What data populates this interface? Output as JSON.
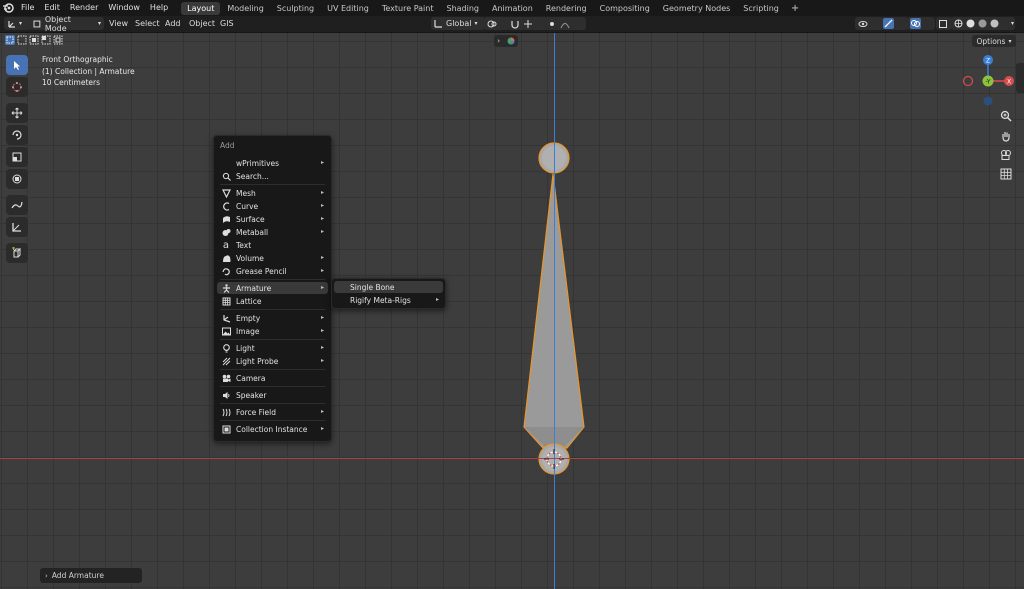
{
  "topbar": {
    "menus": [
      "File",
      "Edit",
      "Render",
      "Window",
      "Help"
    ],
    "workspaces": [
      "Layout",
      "Modeling",
      "Sculpting",
      "UV Editing",
      "Texture Paint",
      "Shading",
      "Animation",
      "Rendering",
      "Compositing",
      "Geometry Nodes",
      "Scripting"
    ],
    "active_workspace": "Layout",
    "add_tab": "+"
  },
  "header": {
    "mode": "Object Mode",
    "menus": [
      "View",
      "Select",
      "Add",
      "Object",
      "GIS"
    ],
    "transform_orientation": "Global",
    "options_label": "Options"
  },
  "viewport": {
    "view_name": "Front Orthographic",
    "collection": "(1) Collection | Armature",
    "scale": "10 Centimeters"
  },
  "gizmo": {
    "z": "Z",
    "y": "-Y",
    "x": "X"
  },
  "add_menu": {
    "title": "Add",
    "items": [
      {
        "label": "wPrimitives",
        "icon": "none",
        "submenu": true
      },
      {
        "label": "Search...",
        "icon": "search-icon",
        "submenu": false
      },
      {
        "label": "Mesh",
        "icon": "mesh-icon",
        "submenu": true
      },
      {
        "label": "Curve",
        "icon": "curve-icon",
        "submenu": true
      },
      {
        "label": "Surface",
        "icon": "surface-icon",
        "submenu": true
      },
      {
        "label": "Metaball",
        "icon": "metaball-icon",
        "submenu": true
      },
      {
        "label": "Text",
        "icon": "text-icon",
        "submenu": false
      },
      {
        "label": "Volume",
        "icon": "volume-icon",
        "submenu": true
      },
      {
        "label": "Grease Pencil",
        "icon": "grease-pencil-icon",
        "submenu": true
      },
      {
        "label": "Armature",
        "icon": "armature-icon",
        "submenu": true
      },
      {
        "label": "Lattice",
        "icon": "lattice-icon",
        "submenu": false
      },
      {
        "label": "Empty",
        "icon": "empty-icon",
        "submenu": true
      },
      {
        "label": "Image",
        "icon": "image-icon",
        "submenu": true
      },
      {
        "label": "Light",
        "icon": "light-icon",
        "submenu": true
      },
      {
        "label": "Light Probe",
        "icon": "light-probe-icon",
        "submenu": true
      },
      {
        "label": "Camera",
        "icon": "camera-icon",
        "submenu": false
      },
      {
        "label": "Speaker",
        "icon": "speaker-icon",
        "submenu": false
      },
      {
        "label": "Force Field",
        "icon": "force-field-icon",
        "submenu": true
      },
      {
        "label": "Collection Instance",
        "icon": "collection-icon",
        "submenu": true
      }
    ],
    "highlighted": "Armature"
  },
  "armature_submenu": {
    "items": [
      {
        "label": "Single Bone",
        "submenu": false
      },
      {
        "label": "Rigify Meta-Rigs",
        "submenu": true
      }
    ],
    "highlighted": "Single Bone"
  },
  "last_operator_panel": {
    "label": "Add Armature"
  },
  "colors": {
    "accent": "#4772b3",
    "bone_outline": "#e8952c",
    "x_axis": "#d94c4c",
    "y_axis": "#8bc43a",
    "z_axis": "#3b7fd9"
  }
}
